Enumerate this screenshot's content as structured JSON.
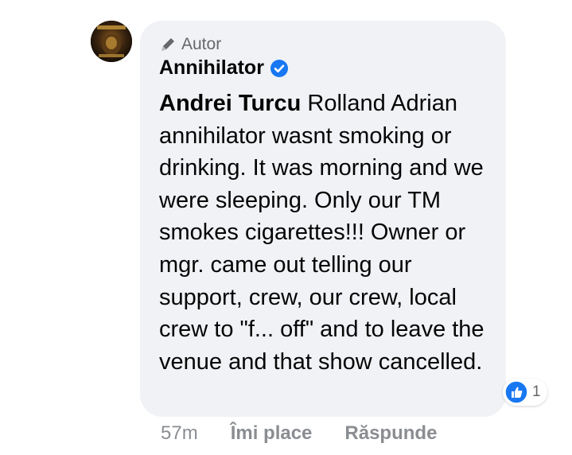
{
  "comment": {
    "author_badge": "Autor",
    "page_name": "Annihilator",
    "mention": "Andrei Turcu",
    "text": " Rolland Adrian annihilator wasnt smoking or drinking. It was morning and we were sleeping. Only our TM smokes cigarettes!!! Owner or mgr. came out telling our support, crew, our crew, local crew to \"f... off\" and to leave the venue and that show cancelled.",
    "reaction_count": "1",
    "timestamp": "57m",
    "like_label": "Îmi place",
    "reply_label": "Răspunde"
  },
  "colors": {
    "bubble_bg": "#f0f2f5",
    "secondary_text": "#65676b",
    "action_text": "#8a8d91",
    "verified_blue": "#1877f2",
    "like_blue": "#1877f2"
  },
  "icons": {
    "badge": "pencil-icon",
    "verified": "verified-badge-icon",
    "reaction": "like-icon"
  }
}
